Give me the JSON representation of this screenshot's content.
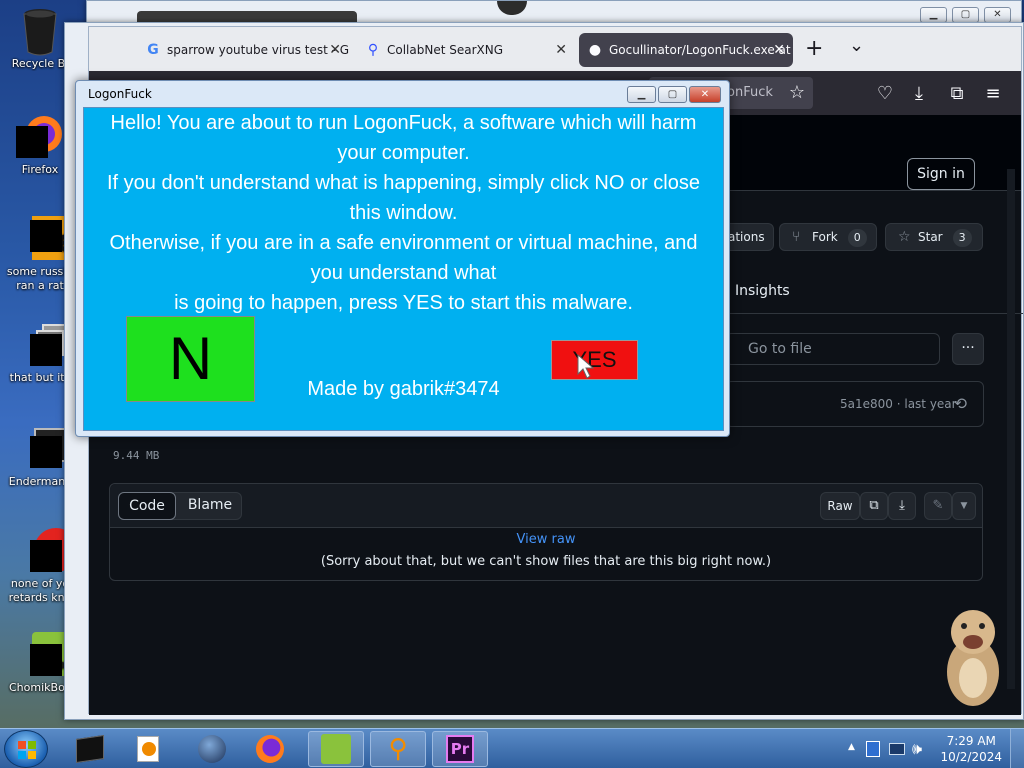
{
  "desktop": {
    "icons": [
      {
        "label": "Recycle Bi"
      },
      {
        "label": "Firefox"
      },
      {
        "label": "some russia",
        "label2": "ran a rat"
      },
      {
        "label": "that but its"
      },
      {
        "label": "Endermanc"
      },
      {
        "label": "none of yo",
        "label2": "retards kno"
      },
      {
        "label": "ChomikBox"
      }
    ]
  },
  "firefox": {
    "tabs": [
      {
        "label": "sparrow youtube virus test - G",
        "icon": "G"
      },
      {
        "label": "CollabNet SearXNG",
        "icon": "search-icon"
      },
      {
        "label": "Gocullinator/LogonFuck.exe at",
        "icon": "github-icon"
      }
    ],
    "new_tab": "+",
    "tab_list": "⌄",
    "url_tail": "onFuck"
  },
  "github": {
    "sign_in": "Sign in",
    "notifications_tail": "ations",
    "fork": {
      "label": "Fork",
      "count": "0"
    },
    "star": {
      "label": "Star",
      "count": "3"
    },
    "insights": "Insights",
    "go_to_file": "Go to file",
    "more": "···",
    "commit": "5a1e800 · last year",
    "file_size": "9.44 MB",
    "code_tab": "Code",
    "blame_tab": "Blame",
    "raw": "Raw",
    "view_raw": "View raw",
    "sorry": "(Sorry about that, but we can't show files that are this big right now.)"
  },
  "dialog": {
    "title": "LogonFuck",
    "lines": [
      "Hello! You are about to run LogonFuck, a software which will harm",
      "your computer.",
      "If you don't understand what is happening, simply click NO or close",
      "this window.",
      "Otherwise, if you are in a safe environment or virtual machine, and",
      "you understand what",
      "is going to happen, press YES to start this malware."
    ],
    "no_button": "N",
    "yes_button": "YES",
    "made_by": "Made by gabrik#3474"
  },
  "taskbar": {
    "time": "7:29 AM",
    "date": "10/2/2024",
    "tray_arrow": "▲"
  }
}
